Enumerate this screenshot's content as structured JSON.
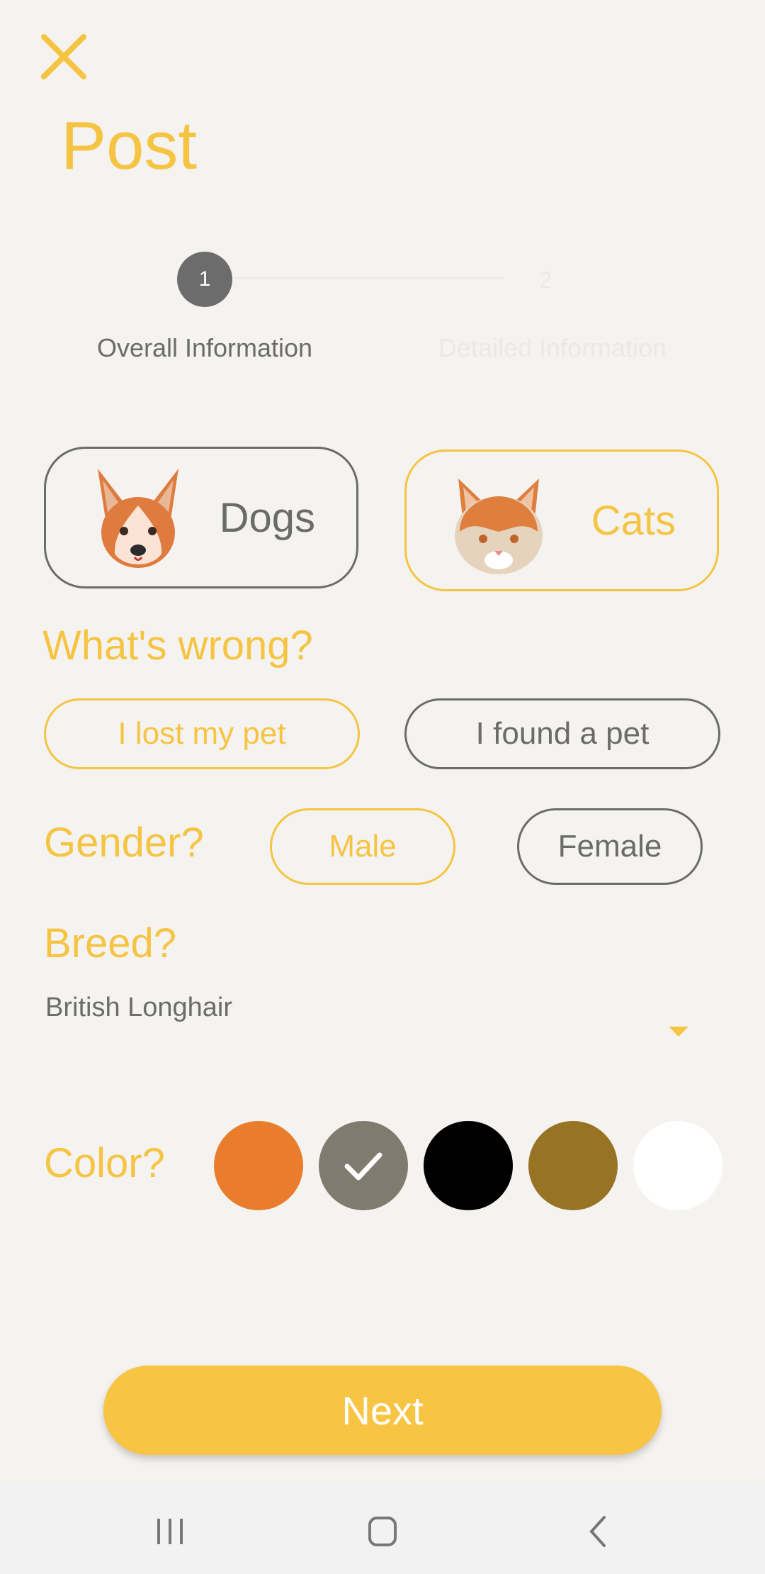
{
  "header": {
    "title": "Post",
    "close_icon": "close-icon"
  },
  "stepper": {
    "steps": [
      {
        "number": "1",
        "label": "Overall Information",
        "active": true
      },
      {
        "number": "2",
        "label": "Detailed Information",
        "active": false
      }
    ]
  },
  "pet_types": [
    {
      "label": "Dogs",
      "icon": "dog-face-icon",
      "selected": false
    },
    {
      "label": "Cats",
      "icon": "cat-face-icon",
      "selected": true
    }
  ],
  "whats_wrong": {
    "question": "What's wrong?",
    "options": [
      {
        "label": "I lost my pet",
        "selected": true
      },
      {
        "label": "I found a pet",
        "selected": false
      }
    ]
  },
  "gender": {
    "question": "Gender?",
    "options": [
      {
        "label": "Male",
        "selected": true
      },
      {
        "label": "Female",
        "selected": false
      }
    ]
  },
  "breed": {
    "question": "Breed?",
    "value": "British Longhair",
    "icon": "dropdown-arrow-icon"
  },
  "color": {
    "question": "Color?",
    "swatches": [
      {
        "name": "orange",
        "hex": "#e97d2b",
        "selected": false
      },
      {
        "name": "gray",
        "hex": "#7f7b6f",
        "selected": true
      },
      {
        "name": "black",
        "hex": "#000000",
        "selected": false
      },
      {
        "name": "brown",
        "hex": "#977323",
        "selected": false
      },
      {
        "name": "white",
        "hex": "#ffffff",
        "selected": false
      }
    ]
  },
  "actions": {
    "next_label": "Next"
  },
  "navbar": {
    "icons": [
      "recent-apps-icon",
      "home-icon",
      "back-icon"
    ]
  },
  "colors": {
    "accent": "#f6c443",
    "button": "#f8c443",
    "text_gray": "#6b6b6b",
    "background": "#f5f3f0"
  }
}
